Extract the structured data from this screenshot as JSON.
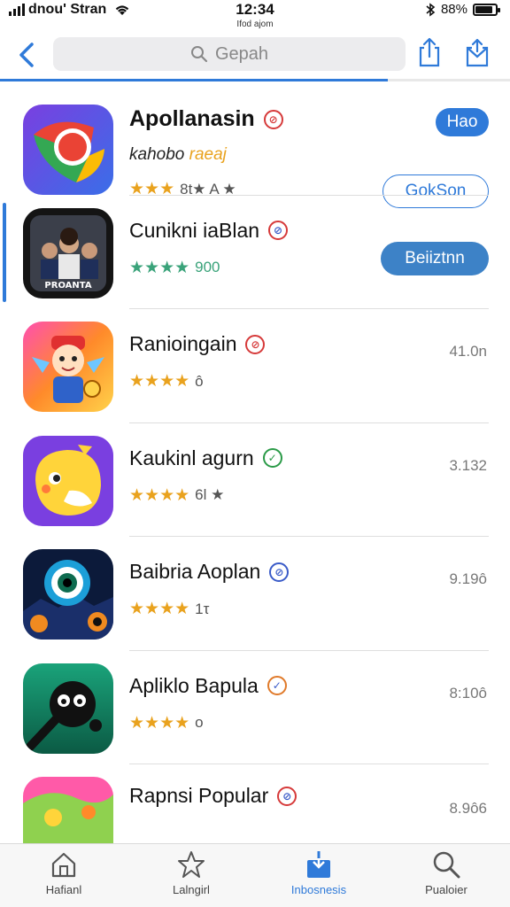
{
  "status_bar": {
    "carrier": "dnou' Stran",
    "time": "12:34",
    "subtitle": "Ifod ajom",
    "battery": "88%"
  },
  "nav": {
    "search_placeholder": "Gepah",
    "icons": [
      "back-chevron-icon",
      "search-icon",
      "share-icon",
      "inbox-icon"
    ],
    "progress": 0.76
  },
  "apps": [
    {
      "name": "Apollanasin",
      "badge_color": "#d63a3a",
      "sub_text": "kahobo ",
      "sub_highlight": "raeaj",
      "stars": "★★★",
      "rating_text": "8t★ A ★",
      "top_button": "Hao",
      "bottom_button": "GokSon",
      "selected": false
    },
    {
      "name": "Cunikni iaBlan",
      "badge_color": "#d63a3a",
      "stars": "★★★★",
      "rating_text": "900",
      "button": "Beiiztnn",
      "selected": true
    },
    {
      "name": "Ranioingain",
      "badge_color": "#d63a3a",
      "stars": "★★★★",
      "rating_text": "ô",
      "right_value": "41.0n",
      "selected": false
    },
    {
      "name": "Kaukinl agurn",
      "badge_color": "#2a9a47",
      "stars": "★★★★",
      "rating_text": "6l ★",
      "right_value": "3.132",
      "selected": false
    },
    {
      "name": "Baibria Aoplan",
      "badge_color": "#3a5bc8",
      "stars": "★★★★",
      "rating_text": "1τ",
      "right_value": "9.19ô",
      "selected": false
    },
    {
      "name": "Apliklo Bapula",
      "badge_color": "#e07a2a",
      "stars": "★★★★",
      "rating_text": "o",
      "right_value": "8:10ô",
      "selected": false
    },
    {
      "name": "Rapnsi Popular",
      "badge_color": "#d63a3a",
      "right_value": "8.9ô6",
      "selected": false
    }
  ],
  "tabs": [
    {
      "label": "Hafianl",
      "icon": "home-icon",
      "active": false
    },
    {
      "label": "Lalngirl",
      "icon": "star-icon",
      "active": false
    },
    {
      "label": "Inbosnesis",
      "icon": "download-tray-icon",
      "active": true
    },
    {
      "label": "Pualoier",
      "icon": "search-icon",
      "active": false
    }
  ],
  "colors": {
    "accent": "#2f7ad9",
    "star_gold": "#e9a21e",
    "star_teal": "#3aa37a"
  }
}
